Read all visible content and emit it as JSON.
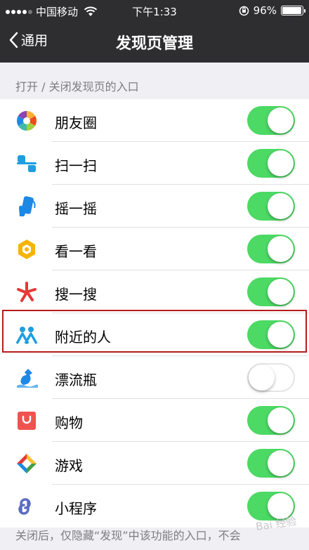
{
  "status_bar": {
    "carrier": "中国移动",
    "time": "下午1:33",
    "battery_percent": "96%",
    "battery_level": 0.96
  },
  "nav": {
    "back_label": "通用",
    "title": "发现页管理"
  },
  "section_header": "打开 / 关闭发现页的入口",
  "items": [
    {
      "label": "朋友圈",
      "icon": "moments-icon",
      "on": true
    },
    {
      "label": "扫一扫",
      "icon": "scan-icon",
      "on": true
    },
    {
      "label": "摇一摇",
      "icon": "shake-icon",
      "on": true
    },
    {
      "label": "看一看",
      "icon": "top-stories-icon",
      "on": true
    },
    {
      "label": "搜一搜",
      "icon": "search-icon",
      "on": true
    },
    {
      "label": "附近的人",
      "icon": "people-nearby-icon",
      "on": true
    },
    {
      "label": "漂流瓶",
      "icon": "drift-bottle-icon",
      "on": false
    },
    {
      "label": "购物",
      "icon": "shopping-icon",
      "on": true
    },
    {
      "label": "游戏",
      "icon": "games-icon",
      "on": true
    },
    {
      "label": "小程序",
      "icon": "mini-programs-icon",
      "on": true
    }
  ],
  "footer_note": "关闭后，仅隐藏“发现”中该功能的入口，不会",
  "watermark": "Bai 经验",
  "colors": {
    "accent": "#4cd964",
    "nav_bg": "#2e2e31",
    "highlight": "#b71c1c"
  }
}
